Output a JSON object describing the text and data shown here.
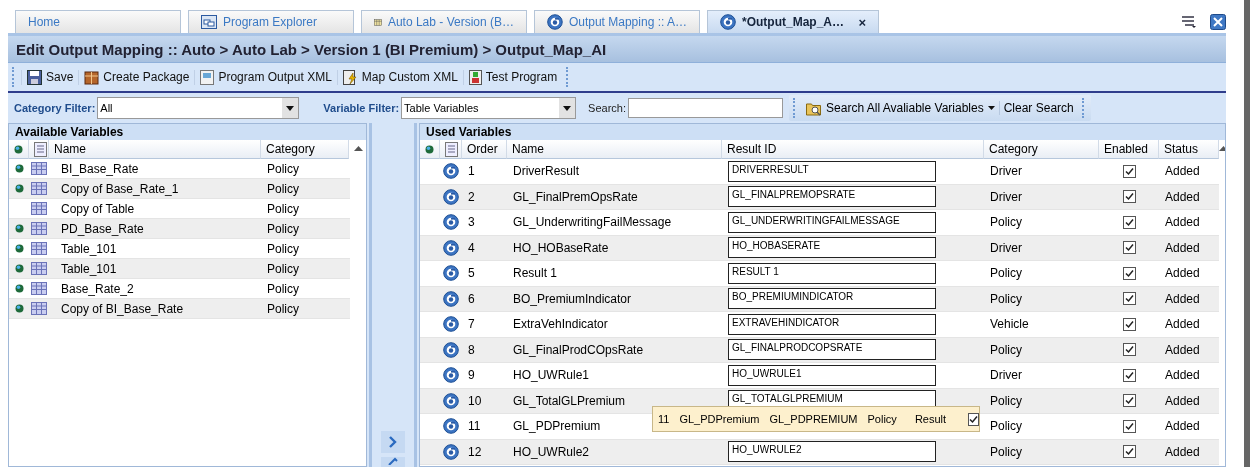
{
  "tabs": [
    {
      "label": "Home",
      "selected": false
    },
    {
      "label": "Program Explorer",
      "selected": false
    },
    {
      "label": "Auto Lab - Version (B…",
      "selected": false
    },
    {
      "label": "Output Mapping :: A…",
      "selected": false
    },
    {
      "label": "*Output_Map_A…",
      "selected": true,
      "close_label": "×"
    }
  ],
  "title": "Edit Output Mapping :: Auto > Auto Lab > Version 1 (BI Premium) > Output_Map_AI",
  "toolbar": [
    {
      "label": "Save"
    },
    {
      "label": "Create Package"
    },
    {
      "label": "Program Output XML"
    },
    {
      "label": "Map Custom XML"
    },
    {
      "label": "Test Program"
    }
  ],
  "filters": {
    "category_label": "Category Filter:",
    "category_value": "All",
    "variable_label": "Variable Filter:",
    "variable_value": "Table Variables",
    "search_label": "Search:",
    "search_all": "Search All Avaliable Variables",
    "clear": "Clear Search"
  },
  "available": {
    "title": "Available Variables",
    "columns": [
      "Name",
      "Category"
    ],
    "rows": [
      {
        "name": "BI_Base_Rate",
        "category": "Policy",
        "active": true
      },
      {
        "name": "Copy of Base_Rate_1",
        "category": "Policy",
        "active": true
      },
      {
        "name": "Copy of Table",
        "category": "Policy",
        "active": false
      },
      {
        "name": "PD_Base_Rate",
        "category": "Policy",
        "active": true
      },
      {
        "name": "Table_101",
        "category": "Policy",
        "active": true
      },
      {
        "name": "Table_101",
        "category": "Policy",
        "active": true
      },
      {
        "name": "Base_Rate_2",
        "category": "Policy",
        "active": true
      },
      {
        "name": "Copy of BI_Base_Rate",
        "category": "Policy",
        "active": true
      }
    ]
  },
  "used": {
    "title": "Used Variables",
    "columns": [
      "Order",
      "Name",
      "Result ID",
      "Category",
      "Enabled",
      "Status"
    ],
    "rows": [
      {
        "order": "1",
        "name": "DriverResult",
        "result_id": "DRIVERRESULT",
        "category": "Driver",
        "enabled": true,
        "status": "Added"
      },
      {
        "order": "2",
        "name": "GL_FinalPremOpsRate",
        "result_id": "GL_FINALPREMOPSRATE",
        "category": "Driver",
        "enabled": true,
        "status": "Added"
      },
      {
        "order": "3",
        "name": "GL_UnderwritingFailMessage",
        "result_id": "GL_UNDERWRITINGFAILMESSAGE",
        "category": "Policy",
        "enabled": true,
        "status": "Added"
      },
      {
        "order": "4",
        "name": "HO_HOBaseRate",
        "result_id": "HO_HOBASERATE",
        "category": "Driver",
        "enabled": true,
        "status": "Added"
      },
      {
        "order": "5",
        "name": "Result 1",
        "result_id": "RESULT 1",
        "category": "Policy",
        "enabled": true,
        "status": "Added"
      },
      {
        "order": "6",
        "name": "BO_PremiumIndicator",
        "result_id": "BO_PREMIUMINDICATOR",
        "category": "Policy",
        "enabled": true,
        "status": "Added"
      },
      {
        "order": "7",
        "name": "ExtraVehIndicator",
        "result_id": "EXTRAVEHINDICATOR",
        "category": "Vehicle",
        "enabled": true,
        "status": "Added"
      },
      {
        "order": "8",
        "name": "GL_FinalProdCOpsRate",
        "result_id": "GL_FINALPRODCOPSRATE",
        "category": "Policy",
        "enabled": true,
        "status": "Added"
      },
      {
        "order": "9",
        "name": "HO_UWRule1",
        "result_id": "HO_UWRULE1",
        "category": "Driver",
        "enabled": true,
        "status": "Added"
      },
      {
        "order": "10",
        "name": "GL_TotalGLPremium",
        "result_id": "GL_TOTALGLPREMIUM",
        "category": "Policy",
        "enabled": true,
        "status": "Added"
      },
      {
        "order": "11",
        "name": "GL_PDPremium",
        "category": "Policy",
        "enabled": true,
        "status": "Added"
      },
      {
        "order": "12",
        "name": "HO_UWRule2",
        "result_id": "HO_UWRULE2",
        "category": "Policy",
        "enabled": true,
        "status": "Added"
      }
    ]
  },
  "drag_proxy": {
    "order": "11",
    "name": "GL_PDPremium",
    "result_id": "GL_PDPREMIUM",
    "category": "Policy",
    "status": "Result",
    "enabled": true
  }
}
